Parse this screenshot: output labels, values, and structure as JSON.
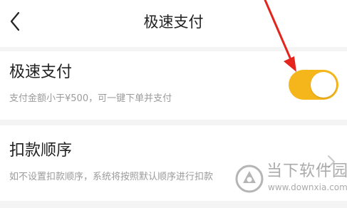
{
  "header": {
    "title": "极速支付",
    "back_icon": "chevron-left-icon"
  },
  "settings": [
    {
      "title": "极速支付",
      "description": "支付金额小于¥500，可一键下单并支付",
      "control": "toggle",
      "toggle_on": true,
      "toggle_color": "#f5b61b"
    },
    {
      "title": "扣款顺序",
      "description": "如不设置扣款顺序，系统将按照默认顺序进行扣款",
      "control": "chevron-right-icon"
    }
  ],
  "annotation": {
    "type": "red-arrow",
    "color": "#e5241d",
    "points_to": "极速支付 toggle"
  },
  "watermark": {
    "name": "当下软件园",
    "url": "www.downxia.com"
  }
}
